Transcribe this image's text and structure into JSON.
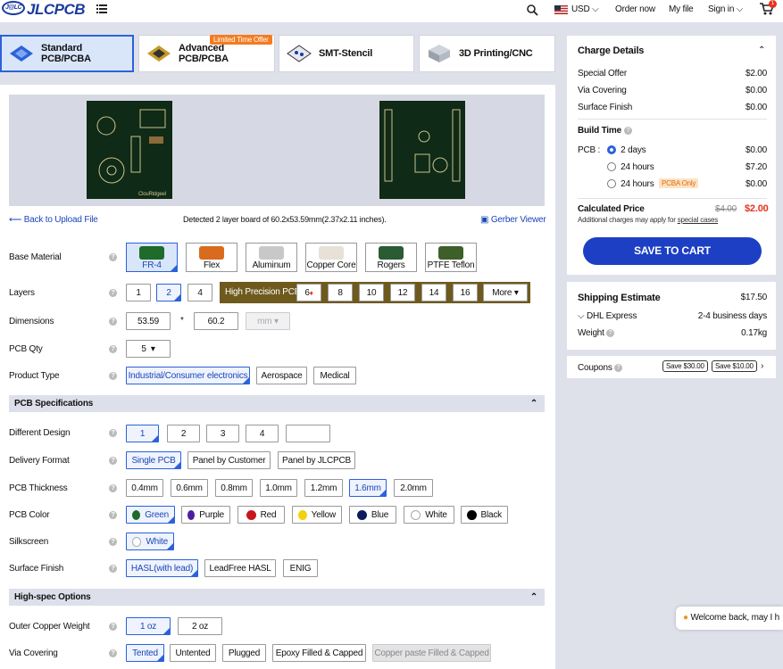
{
  "header": {
    "logo_text": "JLCPCB",
    "logo_mark": "J@LC",
    "currency": "USD",
    "order_now": "Order now",
    "my_file": "My file",
    "sign_in": "Sign in",
    "cart_count": "1"
  },
  "tabs": [
    {
      "label": "Standard PCB/PCBA"
    },
    {
      "label": "Advanced PCB/PCBA",
      "badge": "Limited Time Offer"
    },
    {
      "label": "SMT-Stencil"
    },
    {
      "label": "3D Printing/CNC"
    }
  ],
  "preview": {
    "back_label": "Back to Upload File",
    "detected_text": "Detected 2 layer board of 60.2x53.59mm(2.37x2.11 inches).",
    "gerber_viewer": "Gerber Viewer"
  },
  "form": {
    "base_material": {
      "label": "Base Material",
      "options": [
        "FR-4",
        "Flex",
        "Aluminum",
        "Copper Core",
        "Rogers",
        "PTFE Teflon"
      ],
      "selected": "FR-4"
    },
    "layers": {
      "label": "Layers",
      "options": [
        "1",
        "2",
        "4"
      ],
      "selected": "2",
      "high_precision_label": "High Precision PCB",
      "hp_options": [
        "6",
        "8",
        "10",
        "12",
        "14",
        "16"
      ],
      "more": "More"
    },
    "dimensions": {
      "label": "Dimensions",
      "x": "53.59",
      "times": "*",
      "y": "60.2",
      "unit": "mm"
    },
    "pcb_qty": {
      "label": "PCB Qty",
      "value": "5"
    },
    "product_type": {
      "label": "Product Type",
      "options": [
        "Industrial/Consumer electronics",
        "Aerospace",
        "Medical"
      ],
      "selected": "Industrial/Consumer electronics"
    },
    "pcb_spec_title": "PCB Specifications",
    "different_design": {
      "label": "Different Design",
      "options": [
        "1",
        "2",
        "3",
        "4"
      ],
      "selected": "1"
    },
    "delivery_format": {
      "label": "Delivery Format",
      "options": [
        "Single PCB",
        "Panel by Customer",
        "Panel by JLCPCB"
      ],
      "selected": "Single PCB"
    },
    "pcb_thickness": {
      "label": "PCB Thickness",
      "options": [
        "0.4mm",
        "0.6mm",
        "0.8mm",
        "1.0mm",
        "1.2mm",
        "1.6mm",
        "2.0mm"
      ],
      "selected": "1.6mm"
    },
    "pcb_color": {
      "label": "PCB Color",
      "options": [
        {
          "name": "Green",
          "color": "#1e6b2a"
        },
        {
          "name": "Purple",
          "color": "#4b1fa0"
        },
        {
          "name": "Red",
          "color": "#c8161d"
        },
        {
          "name": "Yellow",
          "color": "#f2d10e"
        },
        {
          "name": "Blue",
          "color": "#0d1b5e"
        },
        {
          "name": "White",
          "color": "#ffffff"
        },
        {
          "name": "Black",
          "color": "#000000"
        }
      ],
      "selected": "Green"
    },
    "silkscreen": {
      "label": "Silkscreen",
      "value": "White"
    },
    "surface_finish": {
      "label": "Surface Finish",
      "options": [
        "HASL(with lead)",
        "LeadFree HASL",
        "ENIG"
      ],
      "selected": "HASL(with lead)"
    },
    "high_spec_title": "High-spec Options",
    "outer_copper": {
      "label": "Outer Copper Weight",
      "options": [
        "1 oz",
        "2 oz"
      ],
      "selected": "1 oz"
    },
    "via_covering": {
      "label": "Via Covering",
      "options": [
        "Tented",
        "Untented",
        "Plugged",
        "Epoxy Filled & Capped",
        "Copper paste Filled & Capped"
      ],
      "selected": "Tented"
    }
  },
  "charge": {
    "title": "Charge Details",
    "rows": [
      {
        "label": "Special Offer",
        "value": "$2.00"
      },
      {
        "label": "Via Covering",
        "value": "$0.00"
      },
      {
        "label": "Surface Finish",
        "value": "$0.00"
      }
    ],
    "build_time_title": "Build Time",
    "pcb_label": "PCB :",
    "build_options": [
      {
        "label": "2 days",
        "value": "$0.00",
        "selected": true
      },
      {
        "label": "24 hours",
        "value": "$7.20",
        "selected": false
      },
      {
        "label": "24 hours",
        "value": "$0.00",
        "selected": false,
        "badge": "PCBA Only"
      }
    ],
    "calculated_label": "Calculated Price",
    "old_price": "$4.00",
    "new_price": "$2.00",
    "additional_prefix": "Additional charges may apply for ",
    "additional_link": "special cases",
    "save_button": "SAVE TO CART"
  },
  "shipping": {
    "title": "Shipping Estimate",
    "price": "$17.50",
    "carrier": "DHL Express",
    "days": "2-4 business days",
    "weight_label": "Weight",
    "weight": "0.17kg"
  },
  "coupons": {
    "label": "Coupons",
    "items": [
      "Save $30.00",
      "Save $10.00"
    ]
  },
  "chat": {
    "text": "Welcome back, may I h"
  },
  "colors": {
    "accent": "#2b62d9",
    "save_button": "#1c3fc4",
    "price_red": "#e8321e"
  }
}
